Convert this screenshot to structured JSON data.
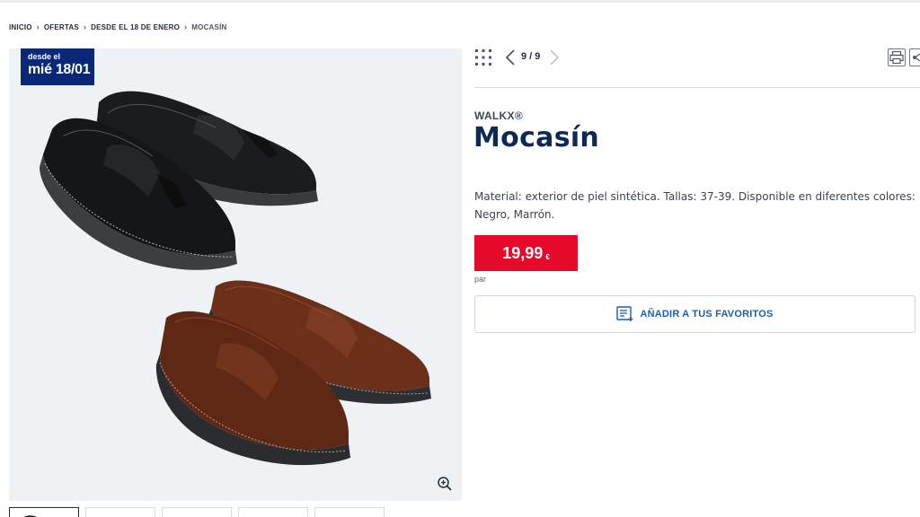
{
  "breadcrumb": {
    "items": [
      "INICIO",
      "OFERTAS",
      "DESDE EL 18 DE ENERO",
      "MOCASÍN"
    ]
  },
  "badge": {
    "line1": "desde el",
    "line2": "mié 18/01"
  },
  "toolbar": {
    "pager": "9 / 9",
    "grid_icon": "grid-icon",
    "prev_icon": "chevron-left-icon",
    "next_icon": "chevron-right-icon",
    "print_icon": "printer-icon",
    "share_icon": "share-icon"
  },
  "product": {
    "brand": "WALKX®",
    "title": "Mocasín",
    "description": "Material: exterior de piel sintética. Tallas: 37-39. Disponible en diferentes colores: Negro, Marrón.",
    "price": "19,99",
    "currency": "€",
    "price_unit": "par"
  },
  "favorites": {
    "label": "AÑADIR A TUS FAVORITOS",
    "icon": "list-add-icon"
  },
  "colors": {
    "brand_blue": "#0a2876",
    "price_red": "#e60a2a",
    "link_blue": "#1a5fa8",
    "title_navy": "#0d2a52"
  }
}
